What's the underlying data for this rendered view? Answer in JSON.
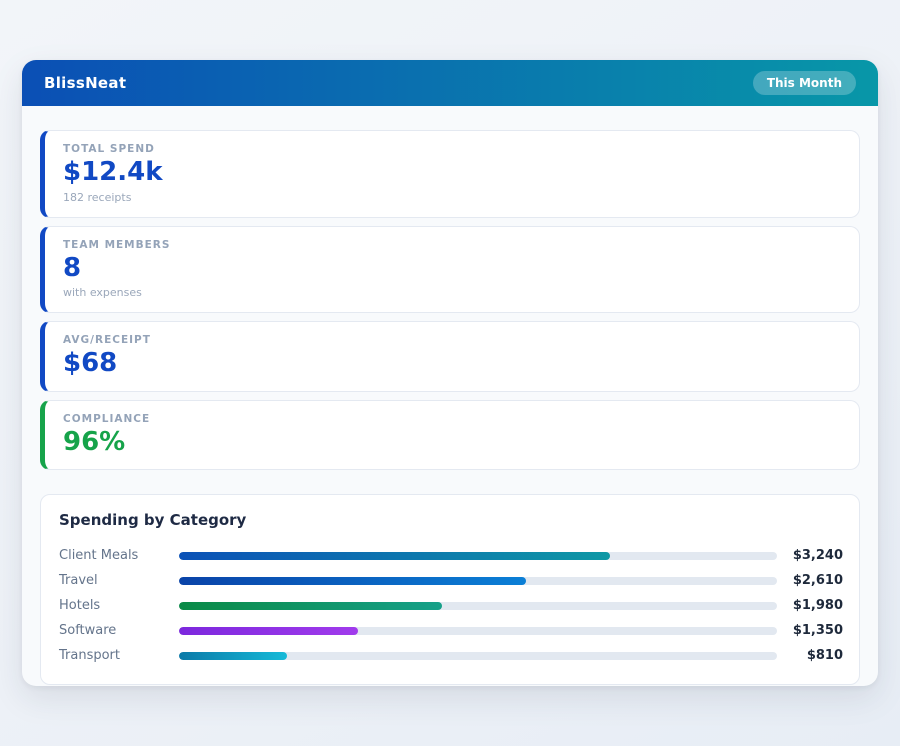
{
  "page": {
    "title": "BlissNeat",
    "period_badge": "This Month"
  },
  "colors": {
    "header_gradient_start": "#0b4fb5",
    "header_gradient_end": "#0897a8",
    "accent_blue": "#1149c4",
    "accent_green": "#16a34a",
    "track": "#e2e8f0"
  },
  "stats": [
    {
      "label": "TOTAL SPEND",
      "value": "$12.4k",
      "sub": "182 receipts",
      "accent": "#1149c4"
    },
    {
      "label": "TEAM MEMBERS",
      "value": "8",
      "sub": "with expenses",
      "accent": "#1149c4"
    },
    {
      "label": "AVG/RECEIPT",
      "value": "$68",
      "sub": "",
      "accent": "#1149c4"
    },
    {
      "label": "COMPLIANCE",
      "value": "96%",
      "sub": "",
      "accent": "#16a34a"
    }
  ],
  "chart_data": {
    "type": "bar",
    "orientation": "horizontal",
    "title": "Spending by Category",
    "categories": [
      "Client Meals",
      "Travel",
      "Hotels",
      "Software",
      "Transport"
    ],
    "values": [
      3240,
      2610,
      1980,
      1350,
      810
    ],
    "value_labels": [
      "$3,240",
      "$2,610",
      "$1,980",
      "$1,350",
      "$810"
    ],
    "axis_max": 4500,
    "grid": false,
    "legend": false,
    "bar_gradients": [
      [
        "#0b51b7",
        "#0e98a5"
      ],
      [
        "#0a43a8",
        "#0b7fd6"
      ],
      [
        "#0a8a46",
        "#16a089"
      ],
      [
        "#7c28dd",
        "#a13bec"
      ],
      [
        "#0b7aa8",
        "#16bad8"
      ]
    ]
  }
}
